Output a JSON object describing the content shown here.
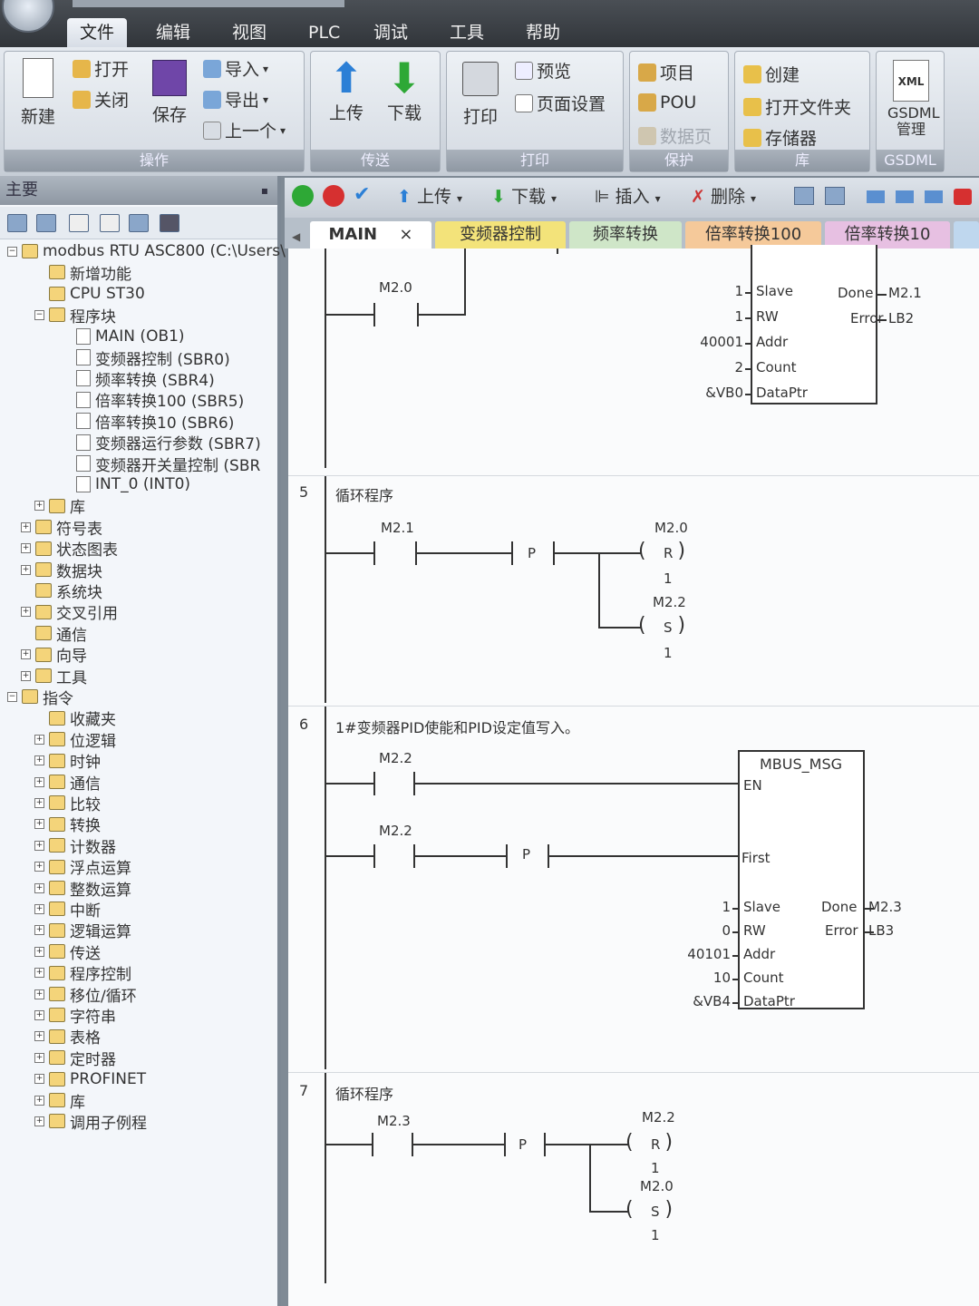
{
  "menu": [
    "文件",
    "编辑",
    "视图",
    "PLC",
    "调试",
    "工具",
    "帮助"
  ],
  "ribbon": {
    "ops": {
      "new": "新建",
      "open": "打开",
      "close": "关闭",
      "save": "保存",
      "import": "导入",
      "export": "导出",
      "prev": "上一个",
      "cap": "操作"
    },
    "transfer": {
      "upload": "上传",
      "download": "下载",
      "cap": "传送"
    },
    "print": {
      "print": "打印",
      "preview": "预览",
      "setup": "页面设置",
      "cap": "打印"
    },
    "protect": {
      "project": "项目",
      "pou": "POU",
      "datapage": "数据页",
      "cap": "保护"
    },
    "lib": {
      "create": "创建",
      "openfolder": "打开文件夹",
      "memory": "存储器",
      "cap": "库"
    },
    "gsdml": {
      "xml": "XML",
      "label": "GSDML管理",
      "cap": "GSDML"
    }
  },
  "left": {
    "title": "主要",
    "tree": [
      {
        "text": "modbus RTU ASC800 (C:\\Users\\",
        "indent": 0,
        "pm": "⊟"
      },
      {
        "text": "新增功能",
        "indent": 1
      },
      {
        "text": "CPU ST30",
        "indent": 1
      },
      {
        "text": "程序块",
        "indent": 1,
        "pm": "⊟"
      },
      {
        "text": "MAIN (OB1)",
        "indent": 2
      },
      {
        "text": "变频器控制 (SBR0)",
        "indent": 2
      },
      {
        "text": "频率转换 (SBR4)",
        "indent": 2
      },
      {
        "text": "倍率转换100 (SBR5)",
        "indent": 2
      },
      {
        "text": "倍率转换10 (SBR6)",
        "indent": 2
      },
      {
        "text": "变频器运行参数 (SBR7)",
        "indent": 2
      },
      {
        "text": "变频器开关量控制 (SBR",
        "indent": 2
      },
      {
        "text": "INT_0 (INT0)",
        "indent": 2
      },
      {
        "text": "库",
        "indent": 1,
        "pm": "⊞"
      },
      {
        "text": "符号表",
        "indent": 0.5,
        "pm": "⊞"
      },
      {
        "text": "状态图表",
        "indent": 0.5,
        "pm": "⊞"
      },
      {
        "text": "数据块",
        "indent": 0.5,
        "pm": "⊞"
      },
      {
        "text": "系统块",
        "indent": 0.5
      },
      {
        "text": "交叉引用",
        "indent": 0.5,
        "pm": "⊞"
      },
      {
        "text": "通信",
        "indent": 0.5
      },
      {
        "text": "向导",
        "indent": 0.5,
        "pm": "⊞"
      },
      {
        "text": "工具",
        "indent": 0.5,
        "pm": "⊞"
      },
      {
        "text": "指令",
        "indent": 0,
        "pm": "⊟"
      },
      {
        "text": "收藏夹",
        "indent": 1
      },
      {
        "text": "位逻辑",
        "indent": 1,
        "pm": "⊞"
      },
      {
        "text": "时钟",
        "indent": 1,
        "pm": "⊞"
      },
      {
        "text": "通信",
        "indent": 1,
        "pm": "⊞"
      },
      {
        "text": "比较",
        "indent": 1,
        "pm": "⊞"
      },
      {
        "text": "转换",
        "indent": 1,
        "pm": "⊞"
      },
      {
        "text": "计数器",
        "indent": 1,
        "pm": "⊞"
      },
      {
        "text": "浮点运算",
        "indent": 1,
        "pm": "⊞"
      },
      {
        "text": "整数运算",
        "indent": 1,
        "pm": "⊞"
      },
      {
        "text": "中断",
        "indent": 1,
        "pm": "⊞"
      },
      {
        "text": "逻辑运算",
        "indent": 1,
        "pm": "⊞"
      },
      {
        "text": "传送",
        "indent": 1,
        "pm": "⊞"
      },
      {
        "text": "程序控制",
        "indent": 1,
        "pm": "⊞"
      },
      {
        "text": "移位/循环",
        "indent": 1,
        "pm": "⊞"
      },
      {
        "text": "字符串",
        "indent": 1,
        "pm": "⊞"
      },
      {
        "text": "表格",
        "indent": 1,
        "pm": "⊞"
      },
      {
        "text": "定时器",
        "indent": 1,
        "pm": "⊞"
      },
      {
        "text": "PROFINET",
        "indent": 1,
        "pm": "⊞"
      },
      {
        "text": "库",
        "indent": 1,
        "pm": "⊞"
      },
      {
        "text": "调用子例程",
        "indent": 1,
        "pm": "⊞"
      }
    ]
  },
  "toolbar": {
    "upload": "上传",
    "download": "下载",
    "insert": "插入",
    "delete": "删除"
  },
  "tabs": [
    "MAIN",
    "变频器控制",
    "频率转换",
    "倍率转换100",
    "倍率转换10"
  ],
  "tab_close": "×",
  "rungs": {
    "r4": {
      "contact": "M2.0",
      "in": [
        "1",
        "1",
        "40001",
        "2",
        "&VB0"
      ],
      "pins": [
        "Slave",
        "RW",
        "Addr",
        "Count",
        "DataPtr"
      ],
      "done": "Done",
      "error": "Error",
      "done_out": "M2.1",
      "error_out": "LB2"
    },
    "r5": {
      "num": "5",
      "comment": "循环程序",
      "contact": "M2.1",
      "p": "P",
      "coil1": "M2.0",
      "c1type": "R",
      "c1n": "1",
      "coil2": "M2.2",
      "c2type": "S",
      "c2n": "1"
    },
    "r6": {
      "num": "6",
      "comment": "1#变频器PID使能和PID设定值写入。",
      "c1": "M2.2",
      "c2": "M2.2",
      "p": "P",
      "title": "MBUS_MSG",
      "en": "EN",
      "first": "First",
      "in": [
        "1",
        "0",
        "40101",
        "10",
        "&VB4"
      ],
      "pins": [
        "Slave",
        "RW",
        "Addr",
        "Count",
        "DataPtr"
      ],
      "done": "Done",
      "error": "Error",
      "done_out": "M2.3",
      "error_out": "LB3"
    },
    "r7": {
      "num": "7",
      "comment": "循环程序",
      "contact": "M2.3",
      "p": "P",
      "coil1": "M2.2",
      "c1type": "R",
      "c1n": "1",
      "coil2": "M2.0",
      "c2type": "S",
      "c2n": "1"
    }
  }
}
